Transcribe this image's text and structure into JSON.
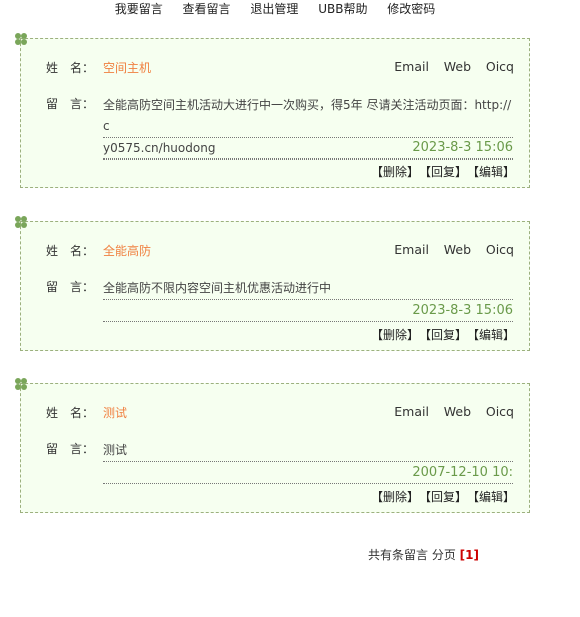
{
  "nav": [
    {
      "label": "我要留言"
    },
    {
      "label": "查看留言"
    },
    {
      "label": "退出管理"
    },
    {
      "label": "UBB帮助"
    },
    {
      "label": "修改密码"
    }
  ],
  "labels": {
    "name": "姓　名：",
    "message": "留　言："
  },
  "links": {
    "email": "Email",
    "web": "Web",
    "oicq": "Oicq"
  },
  "actions": {
    "delete": "【删除】",
    "reply": "【回复】",
    "edit": "【编辑】"
  },
  "entries": [
    {
      "name": "空间主机",
      "message_lines": [
        "全能高防空间主机活动大进行中一次购买，得5年 尽请关注活动页面：http://c",
        "y0575.cn/huodong"
      ],
      "date": "2023-8-3 15:06"
    },
    {
      "name": "全能高防",
      "message_lines": [
        "全能高防不限内容空间主机优惠活动进行中"
      ],
      "date": "2023-8-3 15:06"
    },
    {
      "name": "测试",
      "message_lines": [
        "测试"
      ],
      "date": "2007-12-10 10:"
    }
  ],
  "pager": {
    "text": "共有条留言 分页",
    "current": "[1]"
  },
  "colors": {
    "border": "#9cb07e",
    "background": "#f6fff0",
    "name": "#f08040",
    "date": "#6a9a4a",
    "clover": "#7aa65a"
  }
}
